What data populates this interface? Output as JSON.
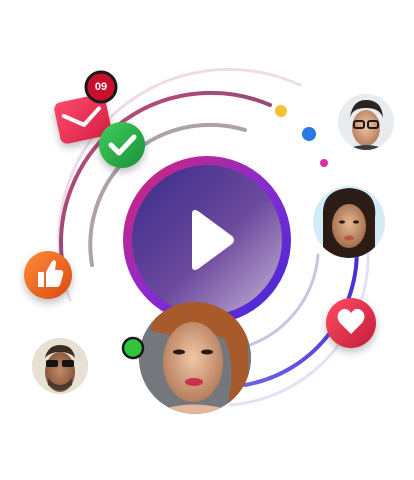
{
  "notification": {
    "badge_count": "09"
  },
  "colors": {
    "accent_purple": "#6a2bd9",
    "accent_pink": "#d8276d",
    "accent_red": "#e63247",
    "accent_orange": "#f26a21",
    "accent_green": "#2ea84a",
    "dot_yellow": "#f5c232",
    "dot_blue": "#2a78e4",
    "dot_magenta": "#e02aa6",
    "online_green": "#31c53b"
  },
  "icons": {
    "play": "play-icon",
    "mail": "mail-icon",
    "check": "check-icon",
    "like": "thumbs-up-icon",
    "heart": "heart-icon"
  }
}
